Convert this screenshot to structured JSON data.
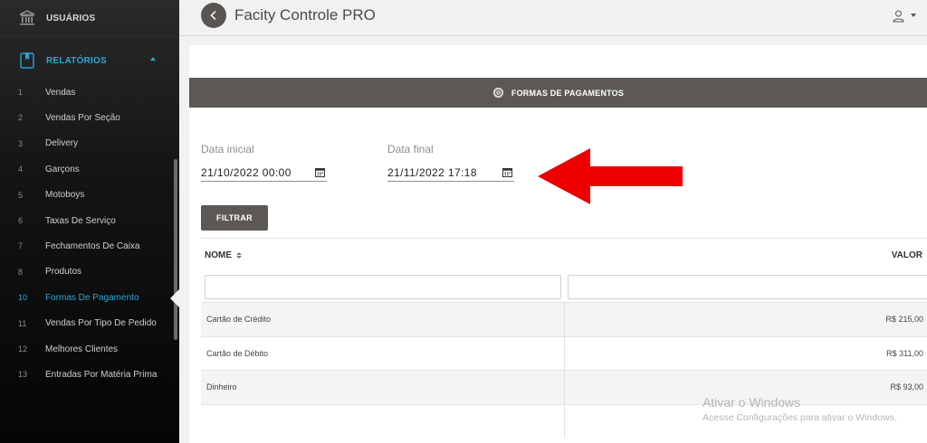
{
  "sidebar": {
    "users_label": "USUÁRIOS",
    "reports_label": "RELATÓRIOS",
    "items": [
      {
        "num": "1",
        "label": "Vendas"
      },
      {
        "num": "2",
        "label": "Vendas Por Seção"
      },
      {
        "num": "3",
        "label": "Delivery"
      },
      {
        "num": "4",
        "label": "Garçons"
      },
      {
        "num": "5",
        "label": "Motoboys"
      },
      {
        "num": "6",
        "label": "Taxas De Serviço"
      },
      {
        "num": "7",
        "label": "Fechamentos De Caixa"
      },
      {
        "num": "8",
        "label": "Produtos"
      },
      {
        "num": "10",
        "label": "Formas De Pagamento"
      },
      {
        "num": "11",
        "label": "Vendas Por Tipo De Pedido"
      },
      {
        "num": "12",
        "label": "Melhores Clientes"
      },
      {
        "num": "13",
        "label": "Entradas Por Matéria Prima"
      }
    ],
    "active_item": "10"
  },
  "header": {
    "title": "Facity Controle PRO"
  },
  "report": {
    "banner_title": "FORMAS DE PAGAMENTOS",
    "start_label": "Data inicial",
    "start_value": "21/10/2022 00:00",
    "end_label": "Data final",
    "end_value": "21/11/2022 17:18",
    "filter_button": "FILTRAR"
  },
  "table": {
    "col_name": "NOME",
    "col_value": "VALOR",
    "rows": [
      {
        "name": "Cartão de Crédito",
        "value": "R$ 215,00"
      },
      {
        "name": "Cartão de Débito",
        "value": "R$ 311,00"
      },
      {
        "name": "Dinheiro",
        "value": "R$ 93,00"
      },
      {
        "name": "",
        "value": ""
      }
    ]
  },
  "watermark": {
    "line1": "Ativar o Windows",
    "line2": "Acesse Configurações para ativar o Windows."
  },
  "colors": {
    "accent": "#2ba6d3",
    "banner": "#5c5955",
    "annotation_arrow": "#ee0000"
  }
}
